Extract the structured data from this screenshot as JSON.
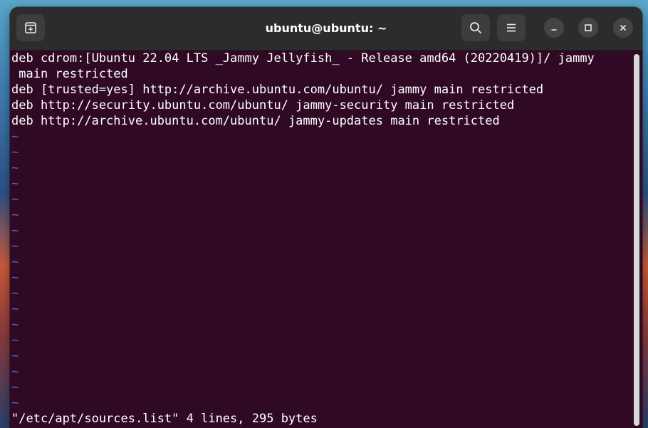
{
  "window": {
    "title": "ubuntu@ubuntu: ~"
  },
  "icons": {
    "new_tab": "new-tab-icon",
    "search": "search-icon",
    "menu": "hamburger-menu-icon",
    "minimize": "minimize-icon",
    "maximize": "maximize-icon",
    "close": "close-icon"
  },
  "editor": {
    "lines": [
      "deb cdrom:[Ubuntu 22.04 LTS _Jammy Jellyfish_ - Release amd64 (20220419)]/ jammy",
      " main restricted",
      "deb [trusted=yes] http://archive.ubuntu.com/ubuntu/ jammy main restricted",
      "deb http://security.ubuntu.com/ubuntu/ jammy-security main restricted",
      "deb http://archive.ubuntu.com/ubuntu/ jammy-updates main restricted"
    ],
    "empty_marker": "~",
    "status": "\"/etc/apt/sources.list\" 4 lines, 295 bytes"
  },
  "colors": {
    "terminal_bg": "#300a24",
    "tilde": "#5a61d8",
    "titlebar": "#2c2c2c"
  }
}
